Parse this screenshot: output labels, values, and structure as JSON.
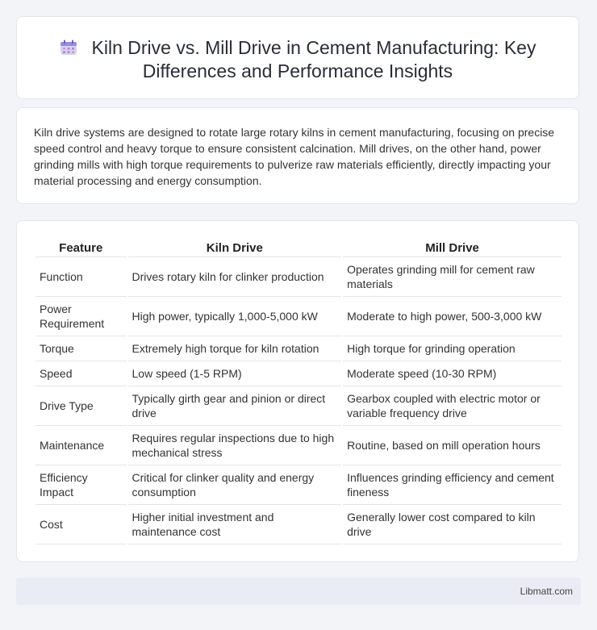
{
  "header": {
    "icon": "calendar-icon",
    "title": "Kiln Drive vs. Mill Drive in Cement Manufacturing: Key Differences and Performance Insights"
  },
  "intro": {
    "text": "Kiln drive systems are designed to rotate large rotary kilns in cement manufacturing, focusing on precise speed control and heavy torque to ensure consistent calcination. Mill drives, on the other hand, power grinding mills with high torque requirements to pulverize raw materials efficiently, directly impacting your material processing and energy consumption."
  },
  "table": {
    "headers": [
      "Feature",
      "Kiln Drive",
      "Mill Drive"
    ],
    "rows": [
      [
        "Function",
        "Drives rotary kiln for clinker production",
        "Operates grinding mill for cement raw materials"
      ],
      [
        "Power Requirement",
        "High power, typically 1,000-5,000 kW",
        "Moderate to high power, 500-3,000 kW"
      ],
      [
        "Torque",
        "Extremely high torque for kiln rotation",
        "High torque for grinding operation"
      ],
      [
        "Speed",
        "Low speed (1-5 RPM)",
        "Moderate speed (10-30 RPM)"
      ],
      [
        "Drive Type",
        "Typically girth gear and pinion or direct drive",
        "Gearbox coupled with electric motor or variable frequency drive"
      ],
      [
        "Maintenance",
        "Requires regular inspections due to high mechanical stress",
        "Routine, based on mill operation hours"
      ],
      [
        "Efficiency Impact",
        "Critical for clinker quality and energy consumption",
        "Influences grinding efficiency and cement fineness"
      ],
      [
        "Cost",
        "Higher initial investment and maintenance cost",
        "Generally lower cost compared to kiln drive"
      ]
    ]
  },
  "footer": {
    "brand": "Libmatt.com"
  }
}
